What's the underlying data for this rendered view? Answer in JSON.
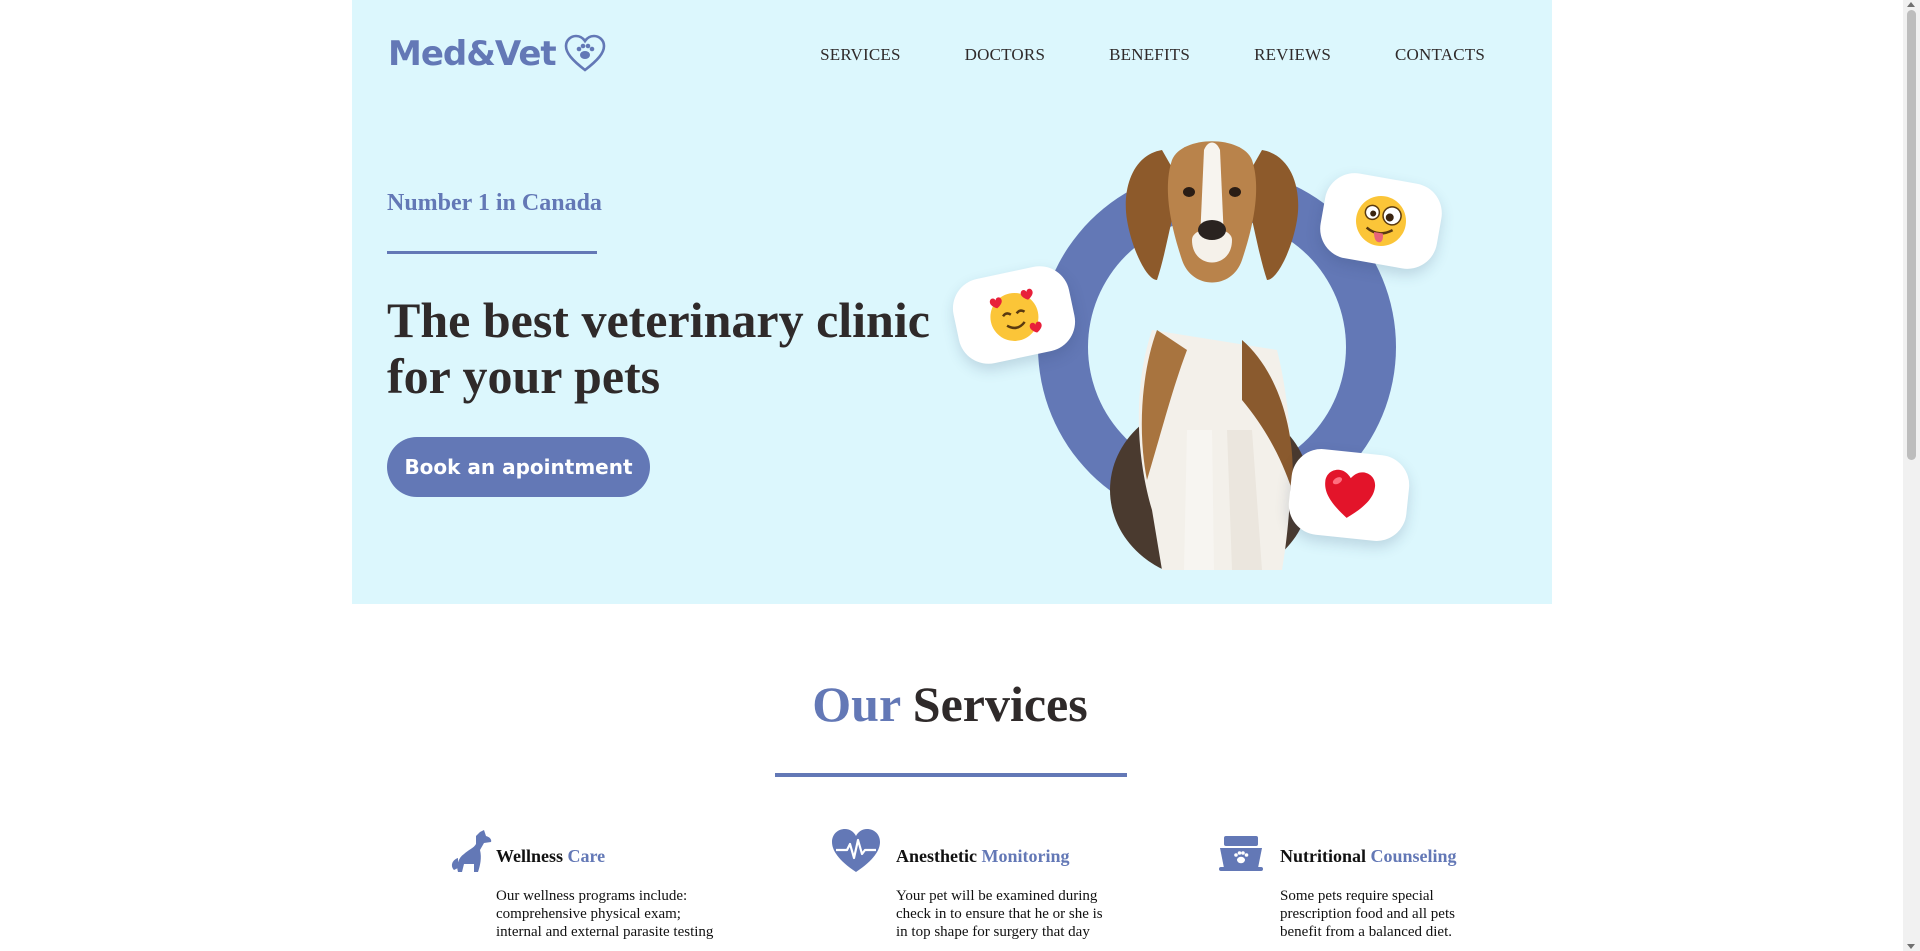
{
  "brand": {
    "name": "Med&Vet",
    "accent_color": "#6378b6",
    "hero_bg": "#dcf7fd",
    "logo_icon": "heart-paw-icon"
  },
  "nav": {
    "items": [
      "SERVICES",
      "DOCTORS",
      "BENEFITS",
      "REVIEWS",
      "CONTACTS"
    ]
  },
  "hero": {
    "eyebrow": "Number 1 in Canada",
    "title": "The best veterinary clinic for your pets",
    "cta_label": "Book an apointment",
    "image": "beagle-dog",
    "bubbles": [
      "smiling-face-with-hearts-emoji",
      "zany-face-emoji",
      "red-heart-emoji"
    ]
  },
  "services": {
    "title_accent": "Our",
    "title_rest": "Services",
    "items": [
      {
        "title": "Wellness",
        "title_accent": "Care",
        "icon": "dog-sitting-icon",
        "desc": "Our wellness programs include: comprehensive physical exam; internal and external parasite testing"
      },
      {
        "title": "Anesthetic",
        "title_accent": "Monitoring",
        "icon": "heart-pulse-icon",
        "desc": "Your pet will be examined during check in to ensure that he or she is in top shape for surgery that day"
      },
      {
        "title": "Nutritional",
        "title_accent": "Counseling",
        "icon": "pet-food-bowl-icon",
        "desc": "Some pets require special prescription food and all pets benefit from a balanced diet."
      }
    ]
  }
}
